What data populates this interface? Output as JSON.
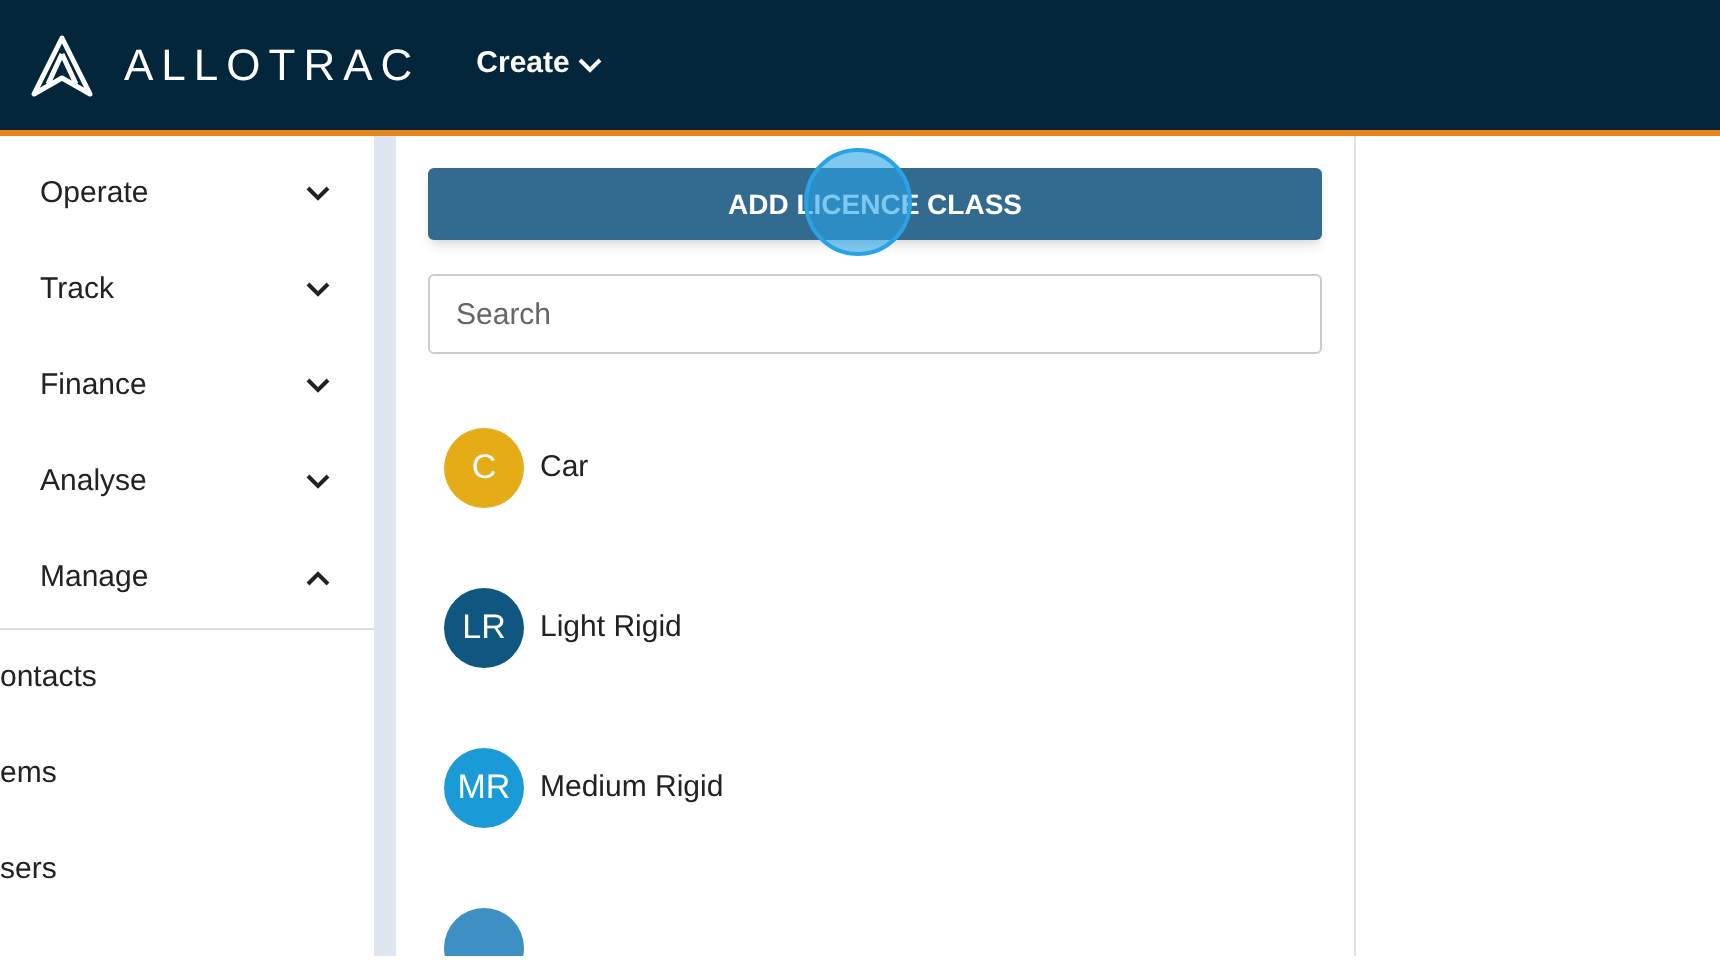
{
  "header": {
    "logo": "ALLOTRAC",
    "menu": "Create"
  },
  "sidebar": {
    "sections": [
      {
        "label": "Operate",
        "expanded": false
      },
      {
        "label": "Track",
        "expanded": false
      },
      {
        "label": "Finance",
        "expanded": false
      },
      {
        "label": "Analyse",
        "expanded": false
      },
      {
        "label": "Manage",
        "expanded": true
      }
    ],
    "items": [
      "ontacts",
      "ems",
      "sers"
    ]
  },
  "main": {
    "button": "ADD LICENCE CLASS",
    "search": {
      "placeholder": "Search"
    },
    "licence_classes": [
      {
        "initials": "C",
        "name": "Car",
        "color": "#e5ac17"
      },
      {
        "initials": "LR",
        "name": "Light Rigid",
        "color": "#0f5680"
      },
      {
        "initials": "MR",
        "name": "Medium Rigid",
        "color": "#1a9ad6"
      },
      {
        "color": "#3d8fc4"
      }
    ]
  }
}
